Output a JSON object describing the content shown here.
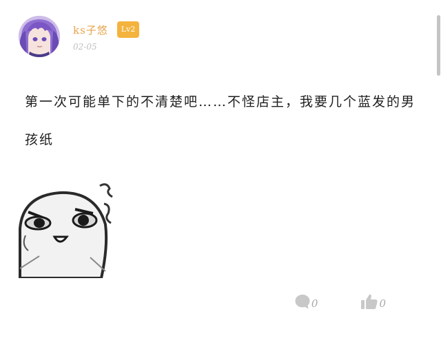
{
  "author": {
    "name": "ks子悠",
    "level": "Lv2",
    "date": "02-05"
  },
  "post": {
    "text": "第一次可能单下的不清楚吧……不怪店主，我要几个蓝发的男孩纸"
  },
  "actions": {
    "comment_count": "0",
    "like_count": "0"
  },
  "icons": {
    "comment": "comment-icon",
    "like": "thumbs-up-icon"
  },
  "colors": {
    "username": "#e8a34a",
    "badge_bg": "#f3b33d",
    "date": "#c0c0c0",
    "text": "#1e1e1e",
    "action_icon": "#c8c8c8"
  }
}
